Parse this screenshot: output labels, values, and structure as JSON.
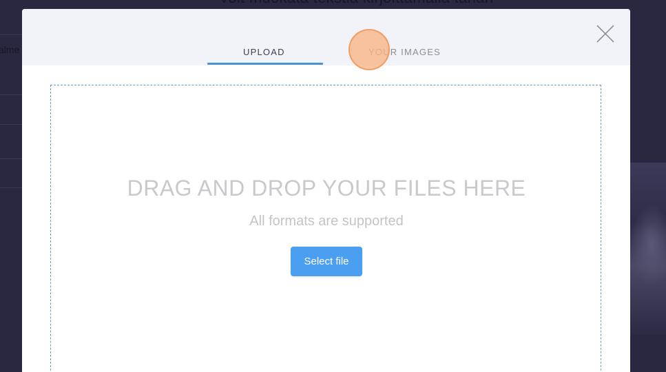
{
  "background": {
    "heading": "voit muokata tekstiä kirjoittamalla tähän",
    "side_text": "alme"
  },
  "modal": {
    "tabs": [
      {
        "label": "UPLOAD",
        "active": true
      },
      {
        "label": "YOUR IMAGES",
        "active": false
      }
    ],
    "close_icon": "close-icon",
    "dropzone": {
      "title": "DRAG AND DROP YOUR FILES HERE",
      "subtitle": "All formats are supported",
      "button_label": "Select file"
    }
  },
  "colors": {
    "accent": "#4a90d9",
    "button": "#4b9ff0",
    "click_indicator": "#f7b282"
  }
}
